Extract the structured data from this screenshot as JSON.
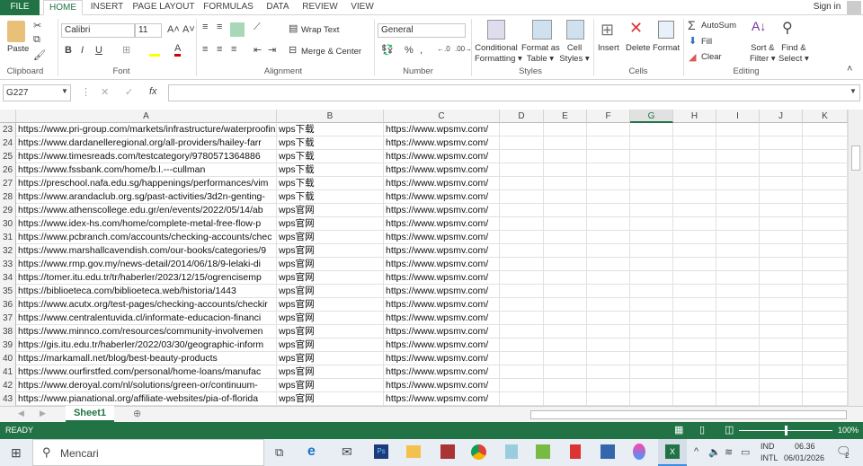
{
  "tabs": [
    "FILE",
    "HOME",
    "INSERT",
    "PAGE LAYOUT",
    "FORMULAS",
    "DATA",
    "REVIEW",
    "VIEW"
  ],
  "sign_in": "Sign in",
  "ribbon": {
    "clipboard": {
      "paste": "Paste",
      "group": "Clipboard"
    },
    "font": {
      "name": "Calibri",
      "size": "11",
      "group": "Font",
      "bold": "B",
      "italic": "I",
      "underline": "U"
    },
    "alignment": {
      "wrap": "Wrap Text",
      "merge": "Merge & Center",
      "group": "Alignment"
    },
    "number": {
      "format": "General",
      "percent": "%",
      "comma": ",",
      "group": "Number"
    },
    "styles": {
      "conditional": "Conditional",
      "conditional2": "Formatting",
      "format_table": "Format as",
      "format_table2": "Table",
      "cell_styles": "Cell",
      "cell_styles2": "Styles",
      "group": "Styles"
    },
    "cells": {
      "insert": "Insert",
      "delete": "Delete",
      "format": "Format",
      "group": "Cells"
    },
    "editing": {
      "autosum": "AutoSum",
      "fill": "Fill",
      "clear": "Clear",
      "sort": "Sort &",
      "sort2": "Filter",
      "find": "Find &",
      "find2": "Select",
      "group": "Editing"
    }
  },
  "formula_bar": {
    "name_box": "G227",
    "fx": "fx",
    "value": ""
  },
  "columns": [
    "A",
    "B",
    "C",
    "D",
    "E",
    "F",
    "G",
    "H",
    "I",
    "J",
    "K"
  ],
  "selected_column": "G",
  "rows": [
    {
      "n": "23",
      "a": "https://www.pri-group.com/markets/infrastructure/waterproofing",
      "b": "wps下载",
      "c": "https://www.wpsmv.com/"
    },
    {
      "n": "24",
      "a": "https://www.dardanelleregional.org/all-providers/hailey-farr",
      "b": "wps下载",
      "c": "https://www.wpsmv.com/"
    },
    {
      "n": "25",
      "a": "https://www.timesreads.com/testcategory/9780571364886",
      "b": "wps下载",
      "c": "https://www.wpsmv.com/"
    },
    {
      "n": "26",
      "a": "https://www.fssbank.com/home/b.l.---cullman",
      "b": "wps下载",
      "c": "https://www.wpsmv.com/"
    },
    {
      "n": "27",
      "a": "https://preschool.nafa.edu.sg/happenings/performances/vim",
      "b": "wps下载",
      "c": "https://www.wpsmv.com/"
    },
    {
      "n": "28",
      "a": "https://www.arandaclub.org.sg/past-activities/3d2n-genting-",
      "b": "wps下载",
      "c": "https://www.wpsmv.com/"
    },
    {
      "n": "29",
      "a": "https://www.athenscollege.edu.gr/en/events/2022/05/14/ab",
      "b": "wps官网",
      "c": "https://www.wpsmv.com/"
    },
    {
      "n": "30",
      "a": "https://www.idex-hs.com/home/complete-metal-free-flow-p",
      "b": "wps官网",
      "c": "https://www.wpsmv.com/"
    },
    {
      "n": "31",
      "a": "https://www.pcbranch.com/accounts/checking-accounts/chec",
      "b": "wps官网",
      "c": "https://www.wpsmv.com/"
    },
    {
      "n": "32",
      "a": "https://www.marshallcavendish.com/our-books/categories/9",
      "b": "wps官网",
      "c": "https://www.wpsmv.com/"
    },
    {
      "n": "33",
      "a": "https://www.rmp.gov.my/news-detail/2014/06/18/9-lelaki-di",
      "b": "wps官网",
      "c": "https://www.wpsmv.com/"
    },
    {
      "n": "34",
      "a": "https://tomer.itu.edu.tr/tr/haberler/2023/12/15/ogrencisemp",
      "b": "wps官网",
      "c": "https://www.wpsmv.com/"
    },
    {
      "n": "35",
      "a": "https://biblioeteca.com/biblioeteca.web/historia/1443",
      "b": "wps官网",
      "c": "https://www.wpsmv.com/"
    },
    {
      "n": "36",
      "a": "https://www.acutx.org/test-pages/checking-accounts/checkir",
      "b": "wps官网",
      "c": "https://www.wpsmv.com/"
    },
    {
      "n": "37",
      "a": "https://www.centralentuvida.cl/informate-educacion-financi",
      "b": "wps官网",
      "c": "https://www.wpsmv.com/"
    },
    {
      "n": "38",
      "a": "https://www.minnco.com/resources/community-involvemen",
      "b": "wps官网",
      "c": "https://www.wpsmv.com/"
    },
    {
      "n": "39",
      "a": "https://gis.itu.edu.tr/haberler/2022/03/30/geographic-inform",
      "b": "wps官网",
      "c": "https://www.wpsmv.com/"
    },
    {
      "n": "40",
      "a": "https://markamall.net/blog/best-beauty-products",
      "b": "wps官网",
      "c": "https://www.wpsmv.com/"
    },
    {
      "n": "41",
      "a": "https://www.ourfirstfed.com/personal/home-loans/manufac",
      "b": "wps官网",
      "c": "https://www.wpsmv.com/"
    },
    {
      "n": "42",
      "a": "https://www.deroyal.com/nl/solutions/green-or/continuum-",
      "b": "wps官网",
      "c": "https://www.wpsmv.com/"
    },
    {
      "n": "43",
      "a": "https://www.pianational.org/affiliate-websites/pia-of-florida",
      "b": "wps官网",
      "c": "https://www.wpsmv.com/"
    }
  ],
  "sheet_tab": "Sheet1",
  "status": {
    "text": "READY",
    "zoom": "100%"
  },
  "taskbar": {
    "search": "Mencari",
    "lang1": "IND",
    "lang2": "INTL",
    "time": "06.36",
    "date": "06/01/2026",
    "notifications": "2"
  },
  "colors": {
    "excel_green": "#217346"
  }
}
